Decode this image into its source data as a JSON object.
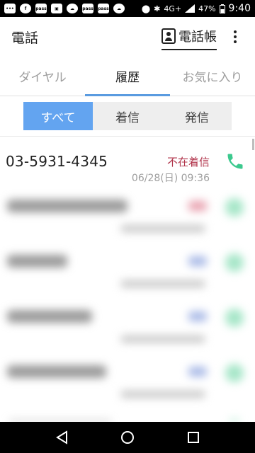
{
  "status_bar": {
    "icons": [
      "message-icon",
      "facebook-icon",
      "pass-icon",
      "photo-icon",
      "weather-icon",
      "pass-icon",
      "pass-icon",
      "weather-icon",
      "location-icon",
      "bluetooth-icon",
      "signal-icon"
    ],
    "pass_label": "pass",
    "network": "4G+",
    "battery": "47%",
    "time": "9:40"
  },
  "app_bar": {
    "title": "電話",
    "phonebook_label": "電話帳"
  },
  "tabs": [
    {
      "label": "ダイヤル",
      "active": false
    },
    {
      "label": "履歴",
      "active": true
    },
    {
      "label": "お気に入り",
      "active": false
    }
  ],
  "filter": [
    {
      "label": "すべて",
      "active": true
    },
    {
      "label": "着信",
      "active": false
    },
    {
      "label": "発信",
      "active": false
    }
  ],
  "call_log": [
    {
      "number": "03-5931-4345",
      "type": "不在着信",
      "time": "06/28(日) 09:36"
    }
  ],
  "colors": {
    "accent": "#5a9be0",
    "segment_active": "#63a4f0",
    "missed": "#b0334a",
    "call_green": "#3cc98e"
  }
}
